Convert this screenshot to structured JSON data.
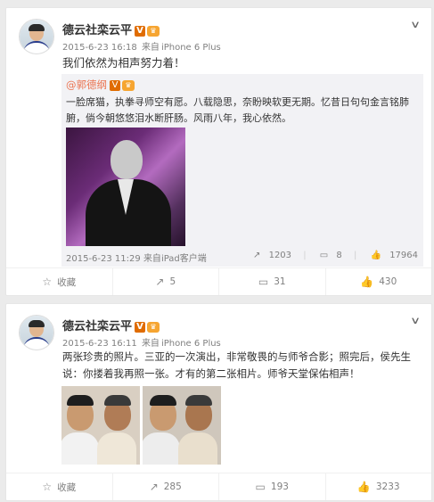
{
  "posts": [
    {
      "author": "德云社栾云平",
      "verified_badge": "V",
      "member_badge": "♛",
      "time": "2015-6-23 16:18",
      "source_prefix": "来自",
      "source": "iPhone 6 Plus",
      "text": "我们依然为相声努力着！",
      "repost": {
        "author": "@郭德纲",
        "verified_badge": "V",
        "member_badge": "♛",
        "text": "一脸席猫，执拳寻师空有愿。八载隐思，奈盼映软更无期。忆昔日句句金言铭肺腑，倘今朝悠悠泪水断肝肠。风雨八年，我心依然。",
        "time": "2015-6-23 11:29",
        "source_prefix": "来自",
        "source": "iPad客户端",
        "reposts": "1203",
        "comments": "8",
        "likes": "17964"
      },
      "actions": {
        "favorite": "收藏",
        "repost": "5",
        "comment": "31",
        "like": "430"
      }
    },
    {
      "author": "德云社栾云平",
      "verified_badge": "V",
      "member_badge": "♛",
      "time": "2015-6-23 16:11",
      "source_prefix": "来自",
      "source": "iPhone 6 Plus",
      "text_line1": "两张珍贵的照片。三亚的一次演出，非常敬畏的与师爷合影；照完后，侯先生",
      "text_line2": "说：你搂着我再照一张。才有的第二张相片。师爷天堂保佑相声！",
      "actions": {
        "favorite": "收藏",
        "repost": "285",
        "comment": "193",
        "like": "3233"
      }
    }
  ],
  "icons": {
    "chevron": "chevron-down-icon",
    "favorite": "star-icon",
    "repost": "repost-icon",
    "comment": "comment-icon",
    "like": "thumbs-up-icon"
  },
  "colors": {
    "link": "#eb7350",
    "badge": "#e06c00",
    "muted": "#808080"
  }
}
